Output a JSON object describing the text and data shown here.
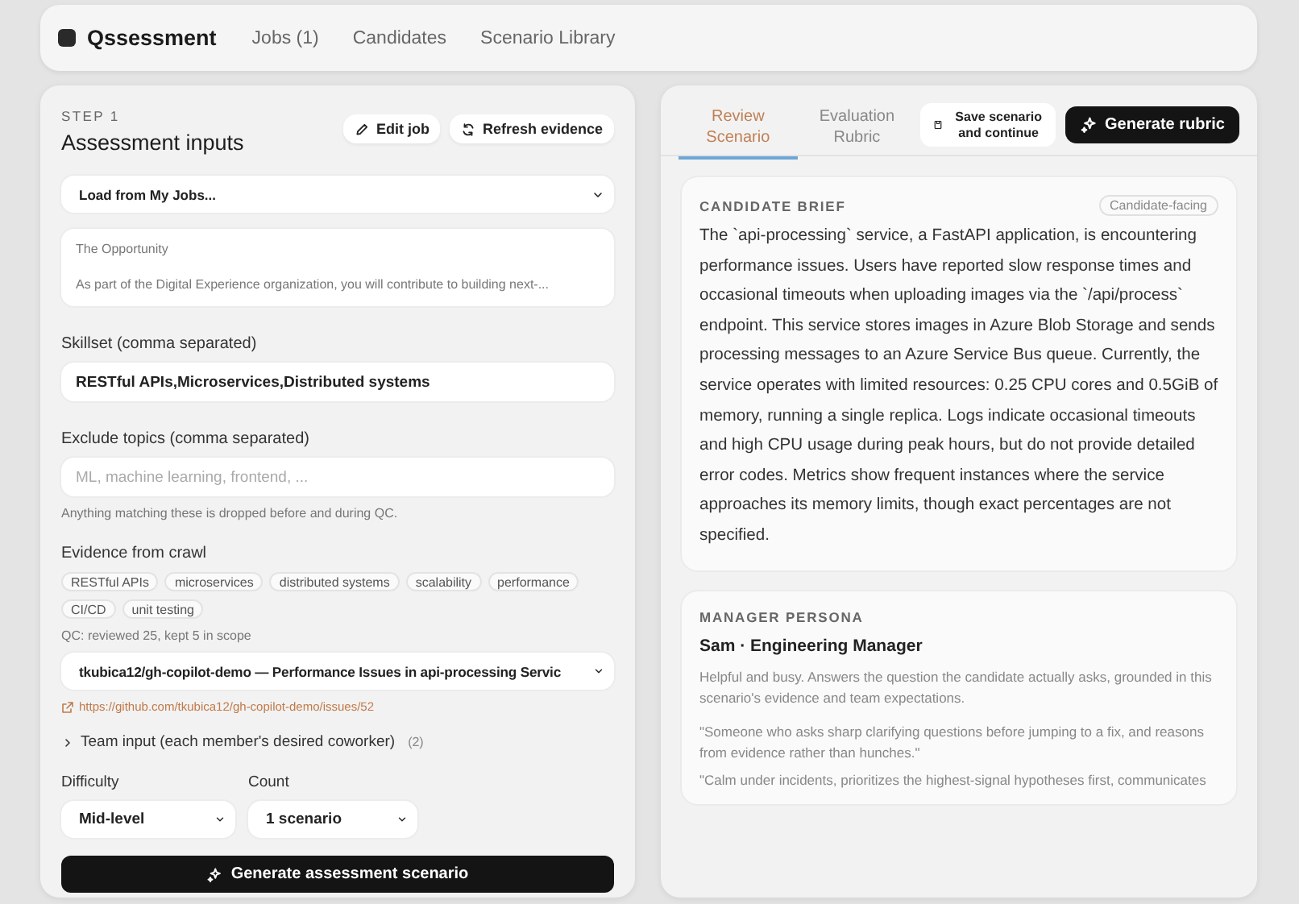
{
  "nav": {
    "brand": "Qssessment",
    "links": [
      {
        "label": "Jobs (1)"
      },
      {
        "label": "Candidates"
      },
      {
        "label": "Scenario Library"
      }
    ]
  },
  "inputs": {
    "step": "STEP 1",
    "title": "Assessment inputs",
    "actions": [
      {
        "label": "Edit job",
        "kind": "edit"
      },
      {
        "label": "Refresh evidence",
        "kind": "refresh"
      }
    ],
    "job_select": "Load from My Jobs...",
    "description": [
      "The Opportunity",
      "As part of the Digital Experience organization, you will contribute to building next-..."
    ],
    "skillset": {
      "label": "Skillset (comma separated)",
      "value": "RESTful APIs,Microservices,Distributed systems"
    },
    "exclude": {
      "label": "Exclude topics (comma separated)",
      "placeholder": "ML, machine learning, frontend, ...",
      "hint": "Anything matching these is dropped before and during QC."
    },
    "evidence": {
      "label": "Evidence from crawl",
      "tags": [
        "RESTful APIs",
        "microservices",
        "distributed systems",
        "scalability",
        "performance",
        "CI/CD",
        "unit testing"
      ],
      "qc": "QC: reviewed 25, kept 5 in scope",
      "source": "tkubica12/gh-copilot-demo — Performance Issues in api-processing Servic",
      "link": "https://github.com/tkubica12/gh-copilot-demo/issues/52"
    },
    "team": {
      "label": "Team input (each member's desired coworker)",
      "count": "(2)",
      "expanded": false
    },
    "difficulty": {
      "label": "Difficulty",
      "value": "Mid-level"
    },
    "count": {
      "label": "Count",
      "value": "1 scenario"
    },
    "generate": "Generate assessment scenario"
  },
  "review": {
    "tabs": [
      {
        "label": "Review Scenario",
        "selected": true
      },
      {
        "label": "Evaluation Rubric",
        "selected": false
      }
    ],
    "save": "Save scenario and continue",
    "generate": "Generate rubric",
    "brief": {
      "heading": "CANDIDATE BRIEF",
      "badge": "Candidate-facing",
      "text": "The `api-processing` service, a FastAPI application, is encountering performance issues. Users have reported slow response times and occasional timeouts when uploading images via the `/api/process` endpoint. This service stores images in Azure Blob Storage and sends processing messages to an Azure Service Bus queue. Currently, the service operates with limited resources: 0.25 CPU cores and 0.5GiB of memory, running a single replica. Logs indicate occasional timeouts and high CPU usage during peak hours, but do not provide detailed error codes. Metrics show frequent instances where the service approaches its memory limits, though exact percentages are not specified."
    },
    "persona": {
      "heading": "MANAGER PERSONA",
      "name": "Sam · Engineering Manager",
      "summary": "Helpful and busy. Answers the question the candidate actually asks, grounded in this scenario's evidence and team expectations.",
      "quotes": [
        "\"Someone who asks sharp clarifying questions before jumping to a fix, and reasons from evidence rather than hunches.\"",
        "\"Calm under incidents, prioritizes the highest-signal hypotheses first, communicates"
      ]
    }
  }
}
